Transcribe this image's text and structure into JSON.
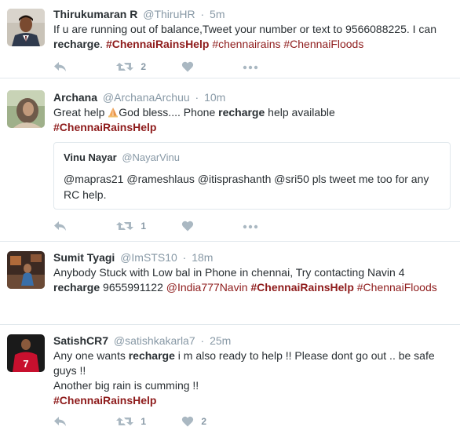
{
  "tweets": [
    {
      "fullname": "Thirukumaran R",
      "username": "@ThiruHR",
      "separator": "·",
      "time": "5m",
      "text_parts": [
        {
          "t": "If u are running out of balance,Tweet your number or text to 9566088225. I can ",
          "k": "plain"
        },
        {
          "t": "recharge",
          "k": "bold"
        },
        {
          "t": ".  ",
          "k": "plain"
        },
        {
          "t": "#ChennaiRainsHelp",
          "k": "hashtag-bold"
        },
        {
          "t": " ",
          "k": "plain"
        },
        {
          "t": "#chennairains",
          "k": "hashtag"
        },
        {
          "t": " ",
          "k": "plain"
        },
        {
          "t": "#ChennaiFloods",
          "k": "hashtag"
        }
      ],
      "retweet_count": "2",
      "like_count": ""
    },
    {
      "fullname": "Archana",
      "username": "@ArchanaArchuu",
      "separator": "·",
      "time": "10m",
      "text_parts": [
        {
          "t": "Great help ",
          "k": "plain"
        },
        {
          "t": "pray-emoji",
          "k": "emoji"
        },
        {
          "t": "God bless.... Phone ",
          "k": "plain"
        },
        {
          "t": "recharge",
          "k": "bold"
        },
        {
          "t": " help available",
          "k": "plain"
        },
        {
          "t": "\n",
          "k": "br"
        },
        {
          "t": "#ChennaiRainsHelp",
          "k": "hashtag-bold"
        }
      ],
      "quote": {
        "fullname": "Vinu Nayar",
        "username": "@NayarVinu",
        "text": "@mapras21 @rameshlaus @itisprashanth @sri50 pls tweet me too for any RC help."
      },
      "retweet_count": "1",
      "like_count": ""
    },
    {
      "fullname": "Sumit Tyagi",
      "username": "@ImSTS10",
      "separator": "·",
      "time": "18m",
      "text_parts": [
        {
          "t": "Anybody Stuck with Low bal in Phone in chennai, Try contacting Navin 4 ",
          "k": "plain"
        },
        {
          "t": "recharge",
          "k": "bold"
        },
        {
          "t": " 9655991122 ",
          "k": "plain"
        },
        {
          "t": "@India777Navin",
          "k": "mention"
        },
        {
          "t": " ",
          "k": "plain"
        },
        {
          "t": "#ChennaiRainsHelp",
          "k": "hashtag-bold"
        },
        {
          "t": " ",
          "k": "plain"
        },
        {
          "t": "#ChennaiFloods",
          "k": "hashtag"
        }
      ],
      "retweet_count": "",
      "like_count": ""
    },
    {
      "fullname": "SatishCR7",
      "username": "@satishkakarla7",
      "separator": "·",
      "time": "25m",
      "text_parts": [
        {
          "t": "Any one wants ",
          "k": "plain"
        },
        {
          "t": "recharge",
          "k": "bold"
        },
        {
          "t": " i m also ready to help !! Please dont go out .. be safe guys !!",
          "k": "plain"
        },
        {
          "t": "\n",
          "k": "br"
        },
        {
          "t": "Another big rain is cumming !!",
          "k": "plain"
        },
        {
          "t": "\n",
          "k": "br"
        },
        {
          "t": "#ChennaiRainsHelp",
          "k": "hashtag-bold"
        }
      ],
      "retweet_count": "1",
      "like_count": "2"
    }
  ],
  "icons": {
    "reply": "reply-icon",
    "retweet": "retweet-icon",
    "like": "heart-icon",
    "more": "more-icon"
  },
  "colors": {
    "hashtag": "#8e1b1b",
    "action_icon": "#aab8c2",
    "muted_text": "#8899a6",
    "border": "#e1e8ed"
  }
}
